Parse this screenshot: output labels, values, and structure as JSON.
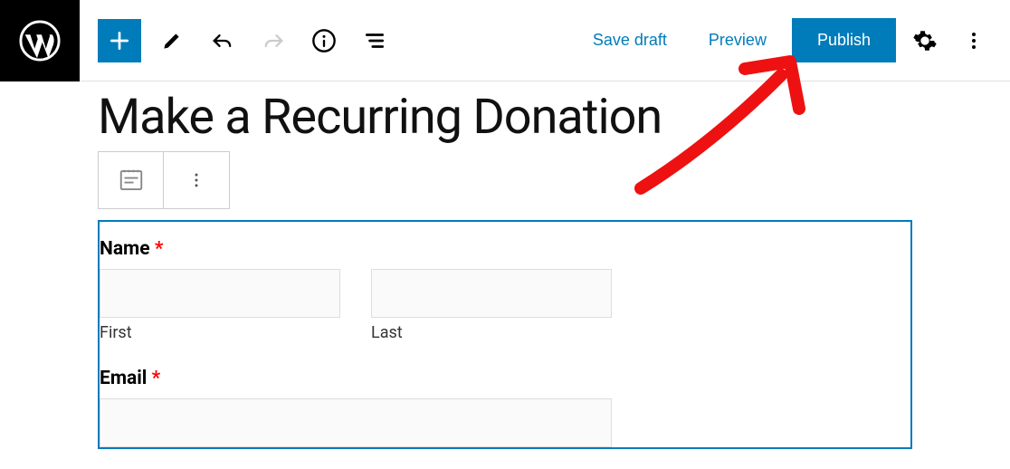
{
  "toolbar": {
    "save_draft_label": "Save draft",
    "preview_label": "Preview",
    "publish_label": "Publish"
  },
  "page": {
    "title": "Make a Recurring Donation"
  },
  "form": {
    "name_label": "Name",
    "first_sublabel": "First",
    "last_sublabel": "Last",
    "email_label": "Email",
    "required_marker": "*"
  }
}
